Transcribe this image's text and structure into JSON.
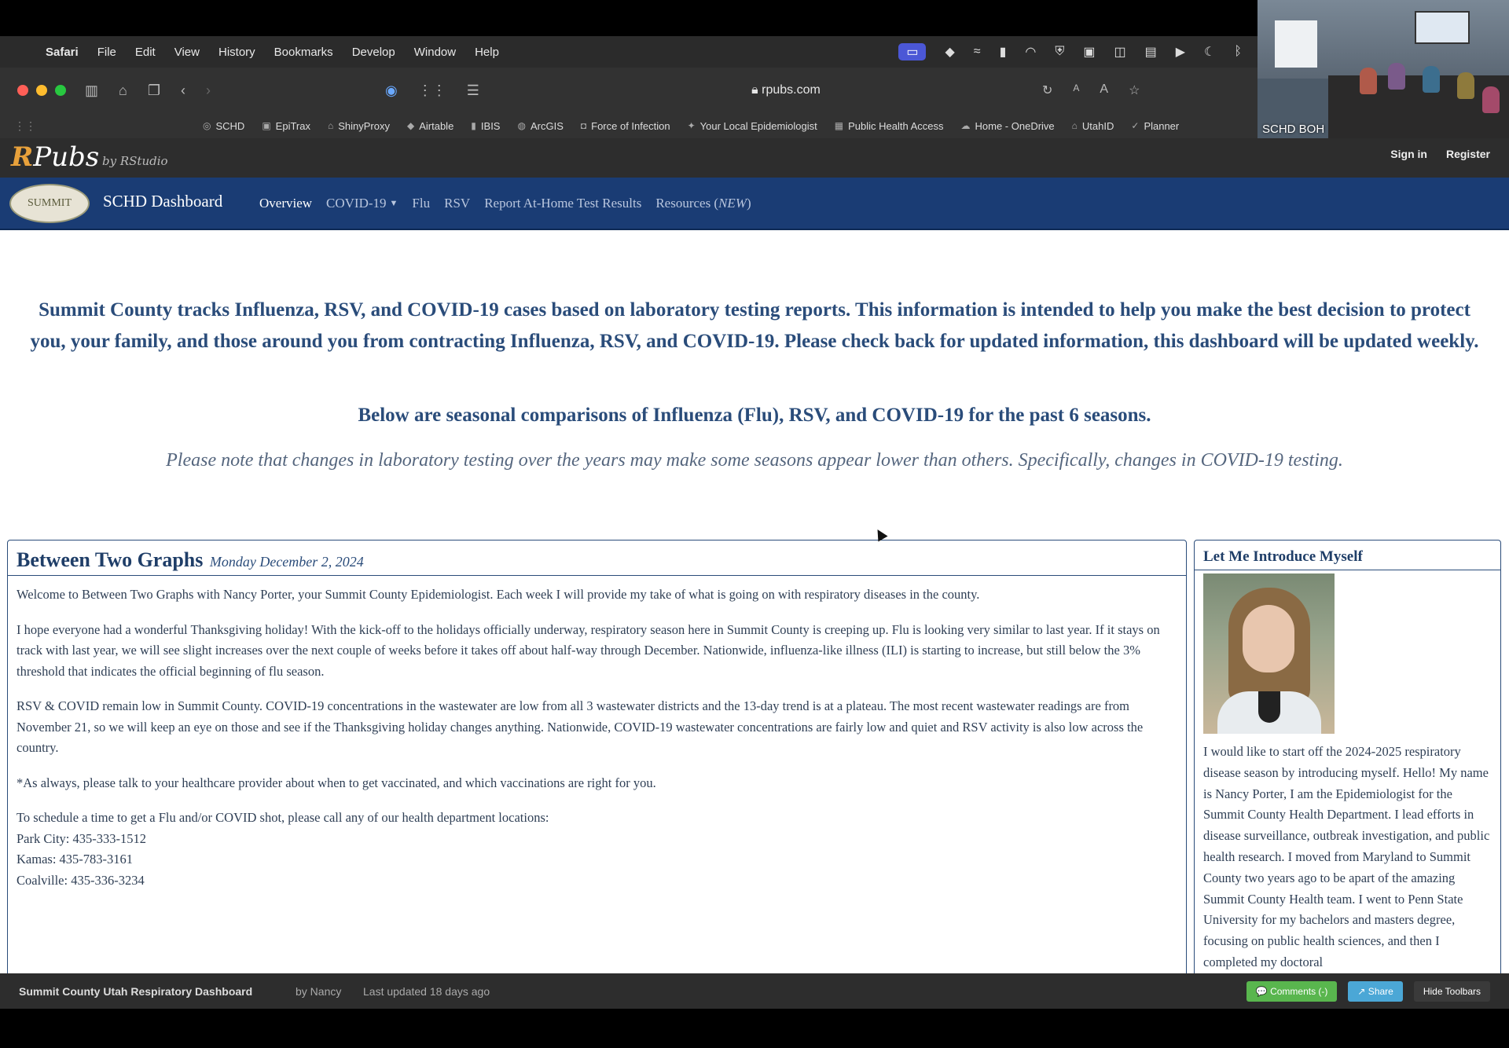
{
  "menubar": {
    "app": "Safari",
    "items": [
      "File",
      "Edit",
      "View",
      "History",
      "Bookmarks",
      "Develop",
      "Window",
      "Help"
    ]
  },
  "browser": {
    "url": "rpubs.com"
  },
  "bookmarks": [
    "SCHD",
    "EpiTrax",
    "ShinyProxy",
    "Airtable",
    "IBIS",
    "ArcGIS",
    "Force of Infection",
    "Your Local Epidemiologist",
    "Public Health Access",
    "Home - OneDrive",
    "UtahID",
    "Planner"
  ],
  "video": {
    "label": "SCHD BOH"
  },
  "rpubs": {
    "logo_r": "R",
    "logo_rest": "Pubs",
    "by": "by RStudio",
    "sign_in": "Sign in",
    "register": "Register"
  },
  "nav": {
    "seal_text": "SUMMIT",
    "brand": "SCHD Dashboard",
    "links": [
      "Overview",
      "COVID-19",
      "Flu",
      "RSV",
      "Report At-Home Test Results",
      "Resources ("
    ],
    "resources_new": "NEW",
    "resources_close": ")"
  },
  "intro": {
    "main": "Summit County tracks Influenza, RSV, and COVID-19 cases based on laboratory testing reports. This information is intended to help you make the best decision to protect you, your family, and those around you from contracting Influenza, RSV, and COVID-19. Please check back for updated information, this dashboard will be updated weekly.",
    "sub": "Below are seasonal comparisons of Influenza (Flu), RSV, and COVID-19 for the past 6 seasons.",
    "note": "Please note that changes in laboratory testing over the years may make some seasons appear lower than others. Specifically, changes in COVID-19 testing."
  },
  "blog": {
    "title": "Between Two Graphs",
    "date": "Monday December 2, 2024",
    "p1": "Welcome to Between Two Graphs with Nancy Porter, your Summit County Epidemiologist. Each week I will provide my take of what is going on with respiratory diseases in the county.",
    "p2": "I hope everyone had a wonderful Thanksgiving holiday! With the kick-off to the holidays officially underway, respiratory season here in Summit County is creeping up. Flu is looking very similar to last year. If it stays on track with last year, we will see slight increases over the next couple of weeks before it takes off about half-way through December. Nationwide, influenza-like illness (ILI) is starting to increase, but still below the 3% threshold that indicates the official beginning of flu season.",
    "p3": "RSV & COVID remain low in Summit County. COVID-19 concentrations in the wastewater are low from all 3 wastewater districts and the 13-day trend is at a plateau. The most recent wastewater readings are from November 21, so we will keep an eye on those and see if the Thanksgiving holiday changes anything. Nationwide, COVID-19 wastewater concentrations are fairly low and quiet and RSV activity is also low across the country.",
    "p4": "*As always, please talk to your healthcare provider about when to get vaccinated, and which vaccinations are right for you.",
    "p5": "To schedule a time to get a Flu and/or COVID shot, please call any of our health department locations:",
    "loc1": "Park City: 435-333-1512",
    "loc2": "Kamas: 435-783-3161",
    "loc3": "Coalville: 435-336-3234"
  },
  "intro_card": {
    "title": "Let Me Introduce Myself",
    "text": "I would like to start off the 2024-2025 respiratory disease season by introducing myself. Hello! My name is Nancy Porter, I am the Epidemiologist for the Summit County Health Department. I lead efforts in disease surveillance, outbreak investigation, and public health research. I moved from Maryland to Summit County two years ago to be apart of the amazing Summit County Health team. I went to Penn State University for my bachelors and masters degree, focusing on public health sciences, and then I completed my doctoral"
  },
  "footer": {
    "title": "Summit County Utah Respiratory Dashboard",
    "by": "by Nancy",
    "updated": "Last updated 18 days ago",
    "comments": "💬 Comments (-)",
    "share": "↗ Share",
    "hide": "Hide Toolbars"
  }
}
